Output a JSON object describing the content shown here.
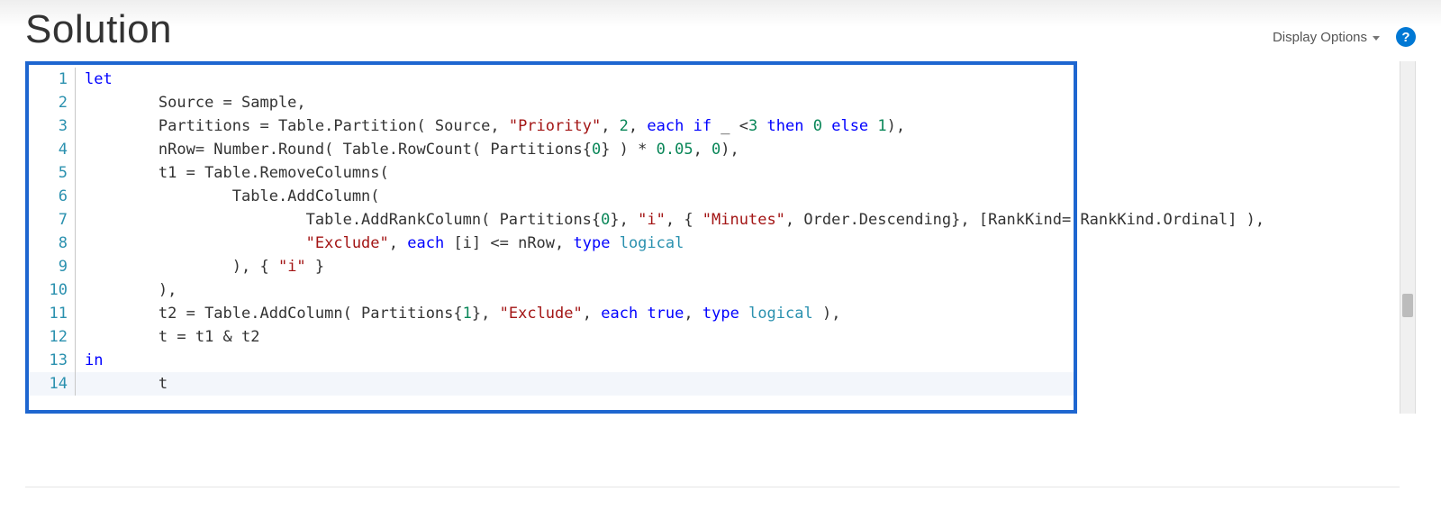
{
  "header": {
    "title": "Solution",
    "display_options_label": "Display Options",
    "help_label": "?"
  },
  "editor": {
    "lines": [
      {
        "n": 1,
        "indent": 0,
        "tokens": [
          [
            "kw",
            "let"
          ]
        ]
      },
      {
        "n": 2,
        "indent": 2,
        "tokens": [
          [
            "ident",
            "Source = Sample,"
          ]
        ]
      },
      {
        "n": 3,
        "indent": 2,
        "tokens": [
          [
            "ident",
            "Partitions = Table.Partition( Source, "
          ],
          [
            "str",
            "\"Priority\""
          ],
          [
            "ident",
            ", "
          ],
          [
            "num",
            "2"
          ],
          [
            "ident",
            ", "
          ],
          [
            "kw",
            "each if"
          ],
          [
            "ident",
            " _ <"
          ],
          [
            "num",
            "3"
          ],
          [
            "ident",
            " "
          ],
          [
            "kw",
            "then"
          ],
          [
            "ident",
            " "
          ],
          [
            "num",
            "0"
          ],
          [
            "ident",
            " "
          ],
          [
            "kw",
            "else"
          ],
          [
            "ident",
            " "
          ],
          [
            "num",
            "1"
          ],
          [
            "ident",
            "),"
          ]
        ]
      },
      {
        "n": 4,
        "indent": 2,
        "tokens": [
          [
            "ident",
            "nRow= Number.Round( Table.RowCount( Partitions{"
          ],
          [
            "num",
            "0"
          ],
          [
            "ident",
            "} ) * "
          ],
          [
            "num",
            "0.05"
          ],
          [
            "ident",
            ", "
          ],
          [
            "num",
            "0"
          ],
          [
            "ident",
            "),"
          ]
        ]
      },
      {
        "n": 5,
        "indent": 2,
        "tokens": [
          [
            "ident",
            "t1 = Table.RemoveColumns("
          ]
        ]
      },
      {
        "n": 6,
        "indent": 4,
        "tokens": [
          [
            "ident",
            "Table.AddColumn("
          ]
        ]
      },
      {
        "n": 7,
        "indent": 6,
        "tokens": [
          [
            "ident",
            "Table.AddRankColumn( Partitions{"
          ],
          [
            "num",
            "0"
          ],
          [
            "ident",
            "}, "
          ],
          [
            "str",
            "\"i\""
          ],
          [
            "ident",
            ", { "
          ],
          [
            "str",
            "\"Minutes\""
          ],
          [
            "ident",
            ", Order.Descending}, [RankKind= RankKind.Ordinal] ),"
          ]
        ]
      },
      {
        "n": 8,
        "indent": 6,
        "tokens": [
          [
            "str",
            "\"Exclude\""
          ],
          [
            "ident",
            ", "
          ],
          [
            "kw",
            "each"
          ],
          [
            "ident",
            " [i] <= nRow, "
          ],
          [
            "kw",
            "type"
          ],
          [
            "ident",
            " "
          ],
          [
            "type",
            "logical"
          ]
        ]
      },
      {
        "n": 9,
        "indent": 4,
        "tokens": [
          [
            "ident",
            "), { "
          ],
          [
            "str",
            "\"i\""
          ],
          [
            "ident",
            " }"
          ]
        ]
      },
      {
        "n": 10,
        "indent": 2,
        "tokens": [
          [
            "ident",
            "),"
          ]
        ]
      },
      {
        "n": 11,
        "indent": 2,
        "tokens": [
          [
            "ident",
            "t2 = Table.AddColumn( Partitions{"
          ],
          [
            "num",
            "1"
          ],
          [
            "ident",
            "}, "
          ],
          [
            "str",
            "\"Exclude\""
          ],
          [
            "ident",
            ", "
          ],
          [
            "kw",
            "each"
          ],
          [
            "ident",
            " "
          ],
          [
            "const",
            "true"
          ],
          [
            "ident",
            ", "
          ],
          [
            "kw",
            "type"
          ],
          [
            "ident",
            " "
          ],
          [
            "type",
            "logical"
          ],
          [
            "ident",
            " ),"
          ]
        ]
      },
      {
        "n": 12,
        "indent": 2,
        "tokens": [
          [
            "ident",
            "t = t1 & t2"
          ]
        ]
      },
      {
        "n": 13,
        "indent": 0,
        "tokens": [
          [
            "kw",
            "in"
          ]
        ]
      },
      {
        "n": 14,
        "indent": 2,
        "tokens": [
          [
            "ident",
            "t"
          ]
        ],
        "current": true
      }
    ]
  }
}
